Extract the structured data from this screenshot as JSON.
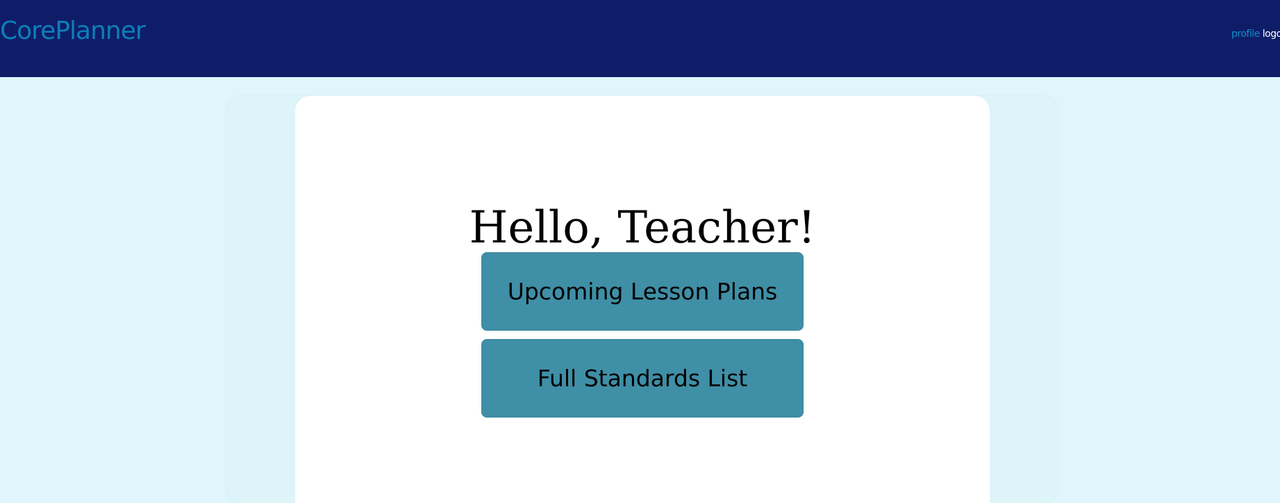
{
  "header": {
    "brand": "CorePlanner",
    "nav": {
      "profile_label": "profile",
      "logout_label": "logout"
    }
  },
  "main": {
    "greeting": "Hello, Teacher!",
    "buttons": {
      "upcoming_label": "Upcoming Lesson Plans",
      "standards_label": "Full Standards List"
    }
  },
  "colors": {
    "header_bg": "#0f1d69",
    "brand": "#0d7fb8",
    "page_bg": "#def6fc",
    "card_bg": "#ffffff",
    "button_bg": "#3f8fa6"
  }
}
